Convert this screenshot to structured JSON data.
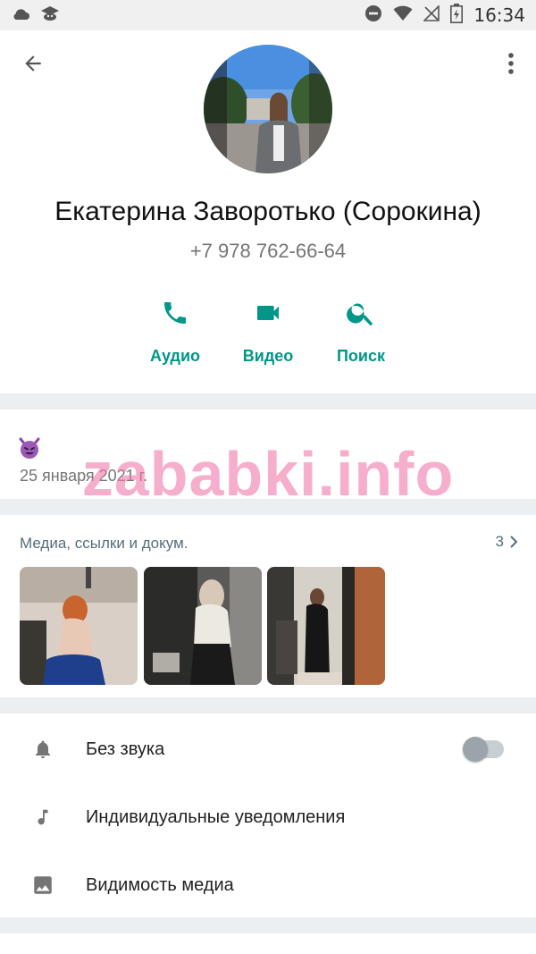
{
  "status_bar": {
    "time": "16:34",
    "icons": [
      "cloud-icon",
      "app-icon",
      "dnd-icon",
      "wifi-icon",
      "no-signal-icon",
      "battery-icon"
    ]
  },
  "contact": {
    "name": "Екатерина Заворотько (Сорокина)",
    "phone": "+7 978 762-66-64"
  },
  "actions": [
    {
      "label": "Аудио",
      "icon": "phone-icon"
    },
    {
      "label": "Видео",
      "icon": "video-icon"
    },
    {
      "label": "Поиск",
      "icon": "search-icon"
    }
  ],
  "about": {
    "emoji": "😈",
    "date": "25 января 2021 г."
  },
  "watermark": "zababki.info",
  "media": {
    "title": "Медиа, ссылки и докум.",
    "count": "3"
  },
  "settings": [
    {
      "label": "Без звука",
      "icon": "bell-icon",
      "toggle": false
    },
    {
      "label": "Индивидуальные уведомления",
      "icon": "music-note-icon"
    },
    {
      "label": "Видимость медиа",
      "icon": "image-icon"
    }
  ],
  "colors": {
    "accent": "#009688",
    "secondary_text": "#757575",
    "background": "#eceff1"
  }
}
